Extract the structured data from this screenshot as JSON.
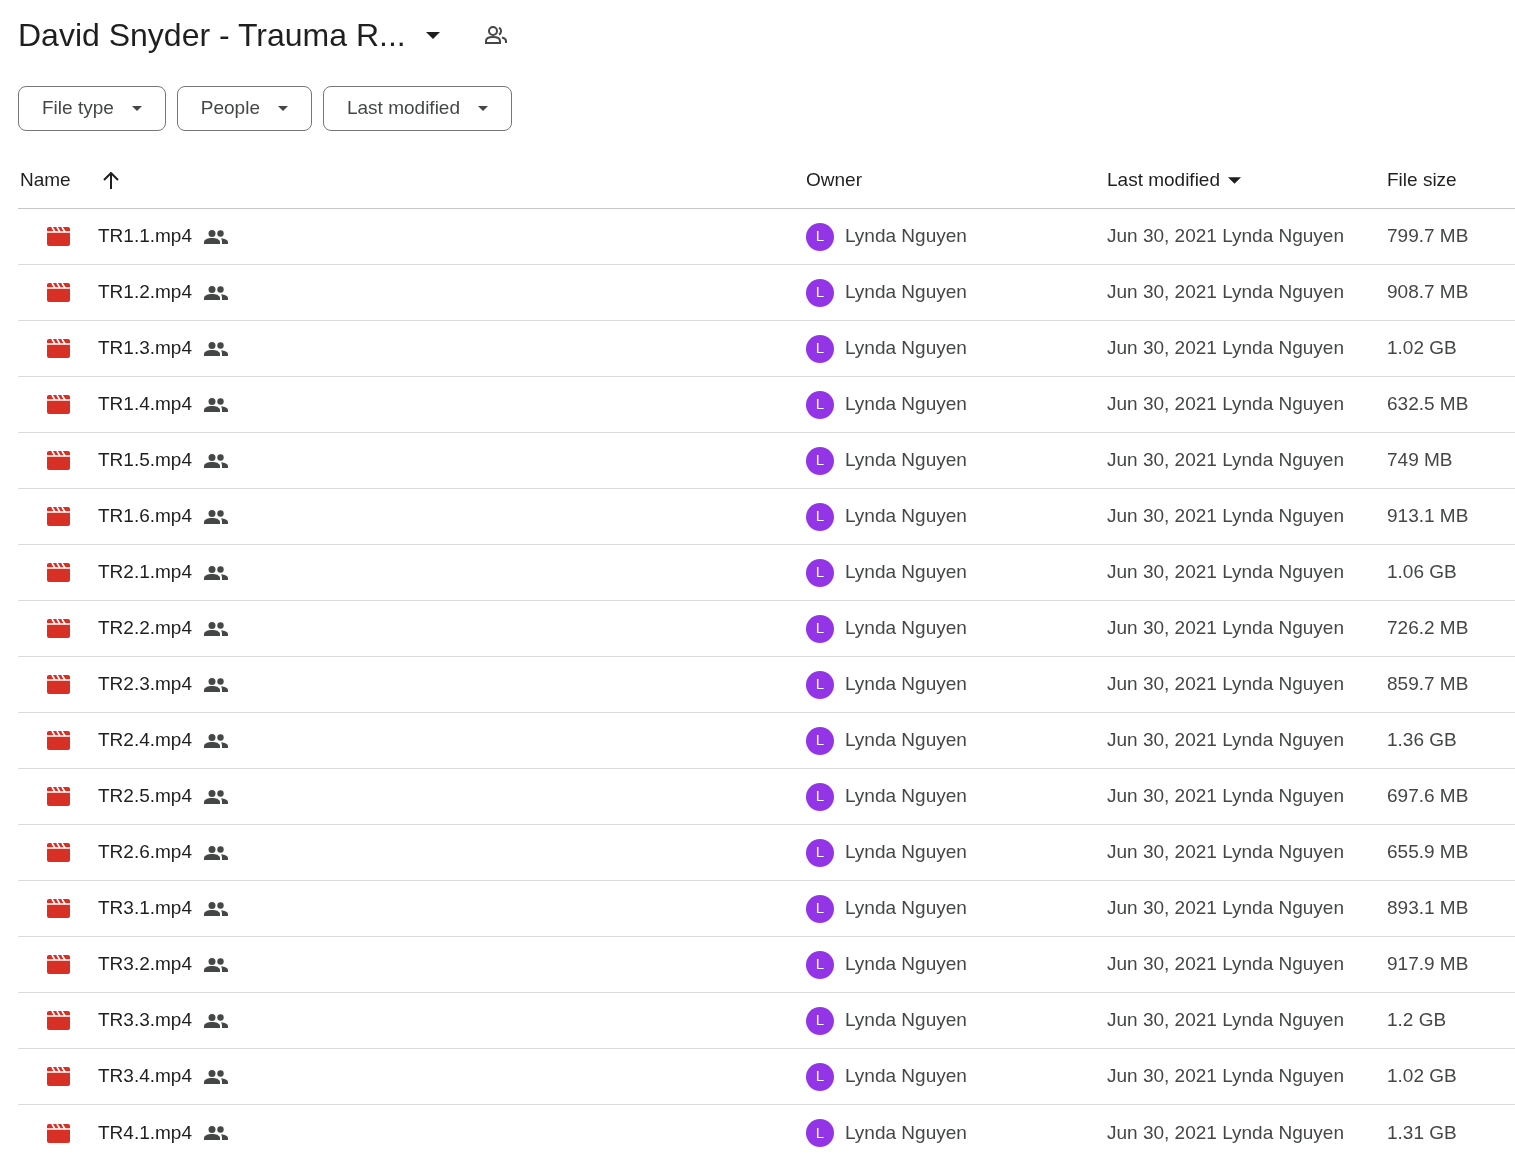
{
  "folder": {
    "title": "David Snyder - Trauma R...",
    "shared": true
  },
  "filters": [
    "File type",
    "People",
    "Last modified"
  ],
  "columns": [
    {
      "label": "Name",
      "kind": "sort-asc"
    },
    {
      "label": "Owner",
      "kind": "plain"
    },
    {
      "label": "Last modified",
      "kind": "dropdown"
    },
    {
      "label": "File size",
      "kind": "plain"
    }
  ],
  "rows": [
    {
      "name": "TR1.1.mp4",
      "shared": true,
      "owner_initial": "L",
      "owner": "Lynda Nguyen",
      "modified": "Jun 30, 2021 Lynda Nguyen",
      "size": "799.7 MB"
    },
    {
      "name": "TR1.2.mp4",
      "shared": true,
      "owner_initial": "L",
      "owner": "Lynda Nguyen",
      "modified": "Jun 30, 2021 Lynda Nguyen",
      "size": "908.7 MB"
    },
    {
      "name": "TR1.3.mp4",
      "shared": true,
      "owner_initial": "L",
      "owner": "Lynda Nguyen",
      "modified": "Jun 30, 2021 Lynda Nguyen",
      "size": "1.02 GB"
    },
    {
      "name": "TR1.4.mp4",
      "shared": true,
      "owner_initial": "L",
      "owner": "Lynda Nguyen",
      "modified": "Jun 30, 2021 Lynda Nguyen",
      "size": "632.5 MB"
    },
    {
      "name": "TR1.5.mp4",
      "shared": true,
      "owner_initial": "L",
      "owner": "Lynda Nguyen",
      "modified": "Jun 30, 2021 Lynda Nguyen",
      "size": "749 MB"
    },
    {
      "name": "TR1.6.mp4",
      "shared": true,
      "owner_initial": "L",
      "owner": "Lynda Nguyen",
      "modified": "Jun 30, 2021 Lynda Nguyen",
      "size": "913.1 MB"
    },
    {
      "name": "TR2.1.mp4",
      "shared": true,
      "owner_initial": "L",
      "owner": "Lynda Nguyen",
      "modified": "Jun 30, 2021 Lynda Nguyen",
      "size": "1.06 GB"
    },
    {
      "name": "TR2.2.mp4",
      "shared": true,
      "owner_initial": "L",
      "owner": "Lynda Nguyen",
      "modified": "Jun 30, 2021 Lynda Nguyen",
      "size": "726.2 MB"
    },
    {
      "name": "TR2.3.mp4",
      "shared": true,
      "owner_initial": "L",
      "owner": "Lynda Nguyen",
      "modified": "Jun 30, 2021 Lynda Nguyen",
      "size": "859.7 MB"
    },
    {
      "name": "TR2.4.mp4",
      "shared": true,
      "owner_initial": "L",
      "owner": "Lynda Nguyen",
      "modified": "Jun 30, 2021 Lynda Nguyen",
      "size": "1.36 GB"
    },
    {
      "name": "TR2.5.mp4",
      "shared": true,
      "owner_initial": "L",
      "owner": "Lynda Nguyen",
      "modified": "Jun 30, 2021 Lynda Nguyen",
      "size": "697.6 MB"
    },
    {
      "name": "TR2.6.mp4",
      "shared": true,
      "owner_initial": "L",
      "owner": "Lynda Nguyen",
      "modified": "Jun 30, 2021 Lynda Nguyen",
      "size": "655.9 MB"
    },
    {
      "name": "TR3.1.mp4",
      "shared": true,
      "owner_initial": "L",
      "owner": "Lynda Nguyen",
      "modified": "Jun 30, 2021 Lynda Nguyen",
      "size": "893.1 MB"
    },
    {
      "name": "TR3.2.mp4",
      "shared": true,
      "owner_initial": "L",
      "owner": "Lynda Nguyen",
      "modified": "Jun 30, 2021 Lynda Nguyen",
      "size": "917.9 MB"
    },
    {
      "name": "TR3.3.mp4",
      "shared": true,
      "owner_initial": "L",
      "owner": "Lynda Nguyen",
      "modified": "Jun 30, 2021 Lynda Nguyen",
      "size": "1.2 GB"
    },
    {
      "name": "TR3.4.mp4",
      "shared": true,
      "owner_initial": "L",
      "owner": "Lynda Nguyen",
      "modified": "Jun 30, 2021 Lynda Nguyen",
      "size": "1.02 GB"
    },
    {
      "name": "TR4.1.mp4",
      "shared": true,
      "owner_initial": "L",
      "owner": "Lynda Nguyen",
      "modified": "Jun 30, 2021 Lynda Nguyen",
      "size": "1.31 GB"
    }
  ]
}
